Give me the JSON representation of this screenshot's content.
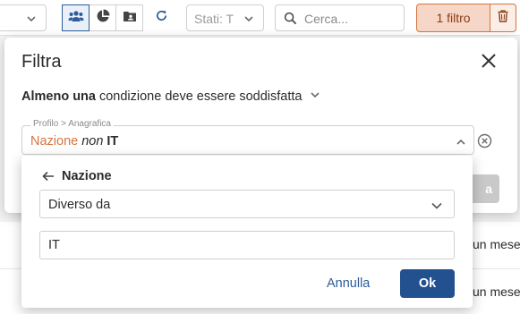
{
  "toolbar": {
    "status_placeholder": "Stati: T",
    "search_placeholder": "Cerca...",
    "filter_count_label": "1 filtro",
    "view_buttons": [
      "group-icon",
      "pie-chart-icon",
      "contact-card-icon"
    ],
    "accent_color": "#2c5c99",
    "filter_color": "#d5753f"
  },
  "background": {
    "row_texts": [
      "un mese",
      "un mese"
    ]
  },
  "modal": {
    "title": "Filtra",
    "condition": {
      "quantifier": "Almeno una",
      "rest": "condizione deve essere soddisfatta"
    },
    "criterion": {
      "legend": "Profilo > Anagrafica",
      "field": "Nazione",
      "operator": "non",
      "value": "IT"
    },
    "apply_label_fragment": "a"
  },
  "popover": {
    "back_label": "Nazione",
    "operator_selected": "Diverso da",
    "value": "IT",
    "cancel_label": "Annulla",
    "ok_label": "Ok"
  }
}
